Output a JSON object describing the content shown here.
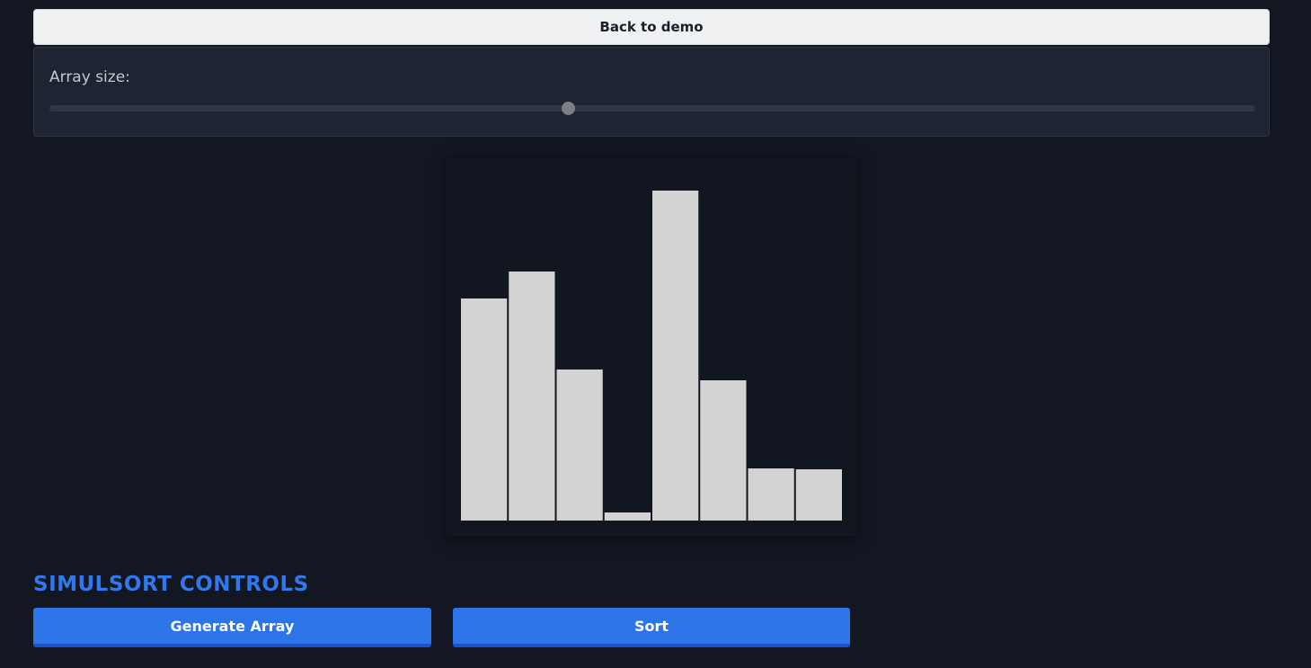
{
  "header": {
    "back_label": "Back to demo"
  },
  "size_control": {
    "label": "Array size:",
    "value_fraction": 0.43
  },
  "bars": {
    "color": "#d3d3d3",
    "values": [
      247,
      277,
      168,
      9,
      367,
      156,
      58,
      57
    ]
  },
  "controls": {
    "title": "SIMULSORT CONTROLS",
    "generate_label": "Generate Array",
    "sort_label": "Sort"
  },
  "colors": {
    "background": "#131722",
    "accent": "#2c74e8",
    "title": "#2f78ee"
  }
}
